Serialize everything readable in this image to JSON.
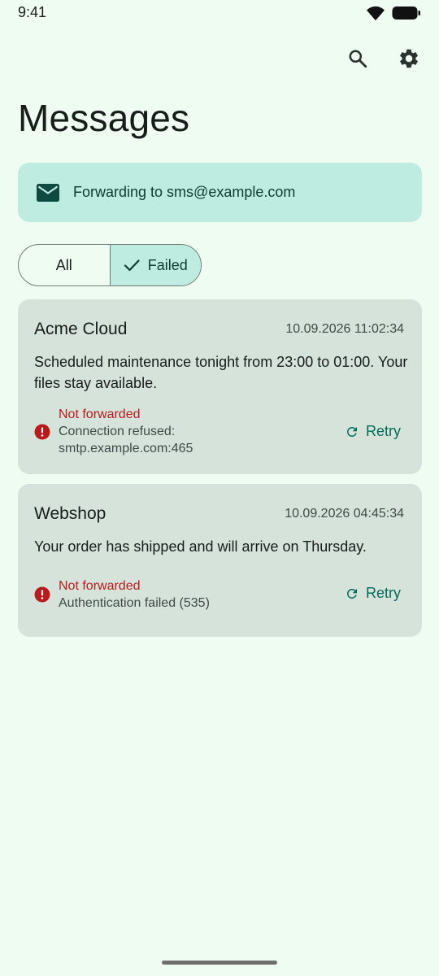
{
  "status_bar": {
    "time": "9:41"
  },
  "header": {
    "title": "Messages",
    "search_icon": "search-icon",
    "settings_icon": "gear-icon"
  },
  "banner": {
    "icon": "mail-icon",
    "text": "Forwarding to sms@example.com"
  },
  "filter": {
    "options": [
      {
        "label": "All",
        "selected": false
      },
      {
        "label": "Failed",
        "selected": true
      }
    ]
  },
  "messages": [
    {
      "sender": "Acme Cloud",
      "timestamp": "10.09.2026 11:02:34",
      "body": "Scheduled maintenance tonight from 23:00 to 01:00. Your files stay available.",
      "status_title": "Not forwarded",
      "status_detail": "Connection refused: smtp.example.com:465",
      "action_label": "Retry"
    },
    {
      "sender": "Webshop",
      "timestamp": "10.09.2026 04:45:34",
      "body": "Your order has shipped and will arrive on Thursday.",
      "status_title": "Not forwarded",
      "status_detail": "Authentication failed (535)",
      "action_label": "Retry"
    }
  ],
  "colors": {
    "background": "#eefcf1",
    "banner": "#bfece0",
    "card": "#d6e3db",
    "error": "#ba1a1a",
    "accent": "#006b58"
  }
}
